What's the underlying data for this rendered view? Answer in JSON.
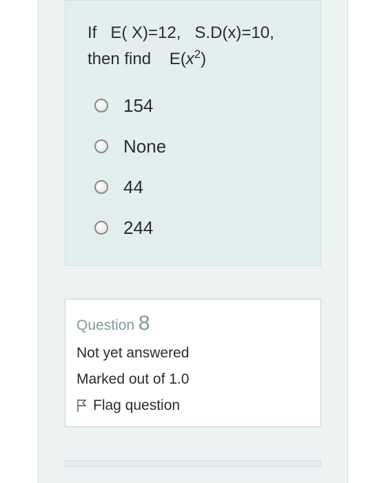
{
  "question": {
    "prompt_prefix": "If",
    "expr1": "E( X)=12,",
    "expr2": "S.D(x)=10,",
    "prompt_mid": "then find",
    "expr3_pre": "E(",
    "expr3_var": "x",
    "expr3_sup": "2",
    "expr3_post": ")",
    "options": [
      {
        "label": "154"
      },
      {
        "label": "None"
      },
      {
        "label": "44"
      },
      {
        "label": "244"
      }
    ]
  },
  "info": {
    "question_word": "Question",
    "question_number": "8",
    "status": "Not yet answered",
    "marks": "Marked out of 1.0",
    "flag_label": "Flag question"
  }
}
